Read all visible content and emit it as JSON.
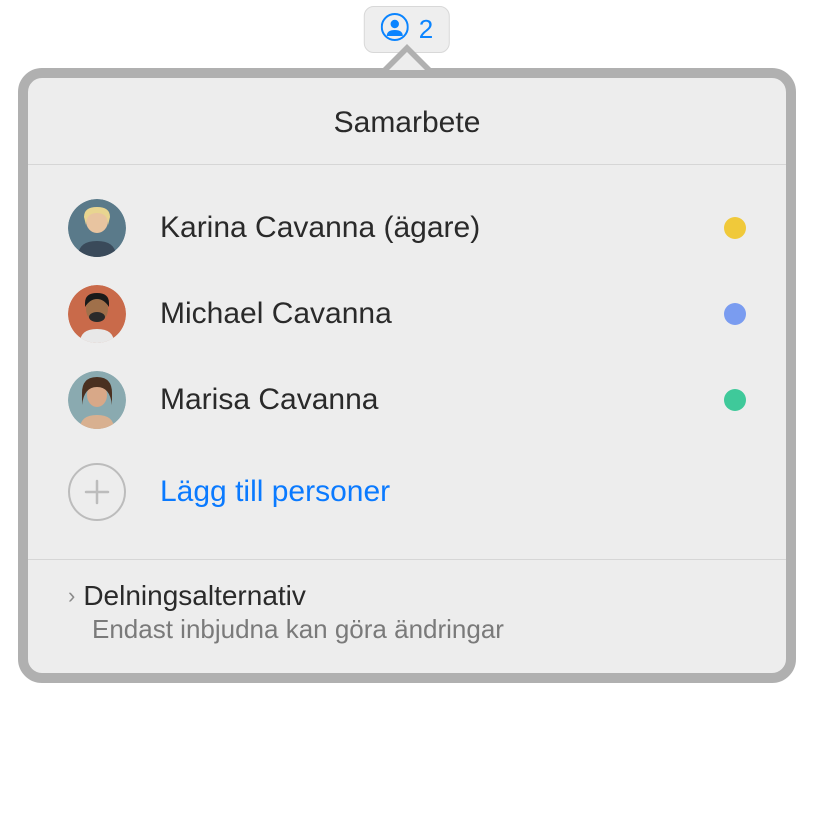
{
  "toolbar": {
    "collaborator_count": "2"
  },
  "popover": {
    "title": "Samarbete",
    "participants": [
      {
        "name": "Karina Cavanna (ägare)",
        "dot_color": "#f0c93a",
        "avatar_bg": "#d4a574",
        "avatar_hair": "#e8d590"
      },
      {
        "name": "Michael Cavanna",
        "dot_color": "#7a9cf0",
        "avatar_bg": "#8b5a3c",
        "avatar_hair": "#2a2a2a"
      },
      {
        "name": "Marisa Cavanna",
        "dot_color": "#3fc99a",
        "avatar_bg": "#c9997a",
        "avatar_hair": "#3a2a1a"
      }
    ],
    "add_label": "Lägg till personer",
    "sharing": {
      "title": "Delningsalternativ",
      "subtitle": "Endast inbjudna kan göra ändringar"
    }
  },
  "colors": {
    "link": "#0a7aff"
  }
}
